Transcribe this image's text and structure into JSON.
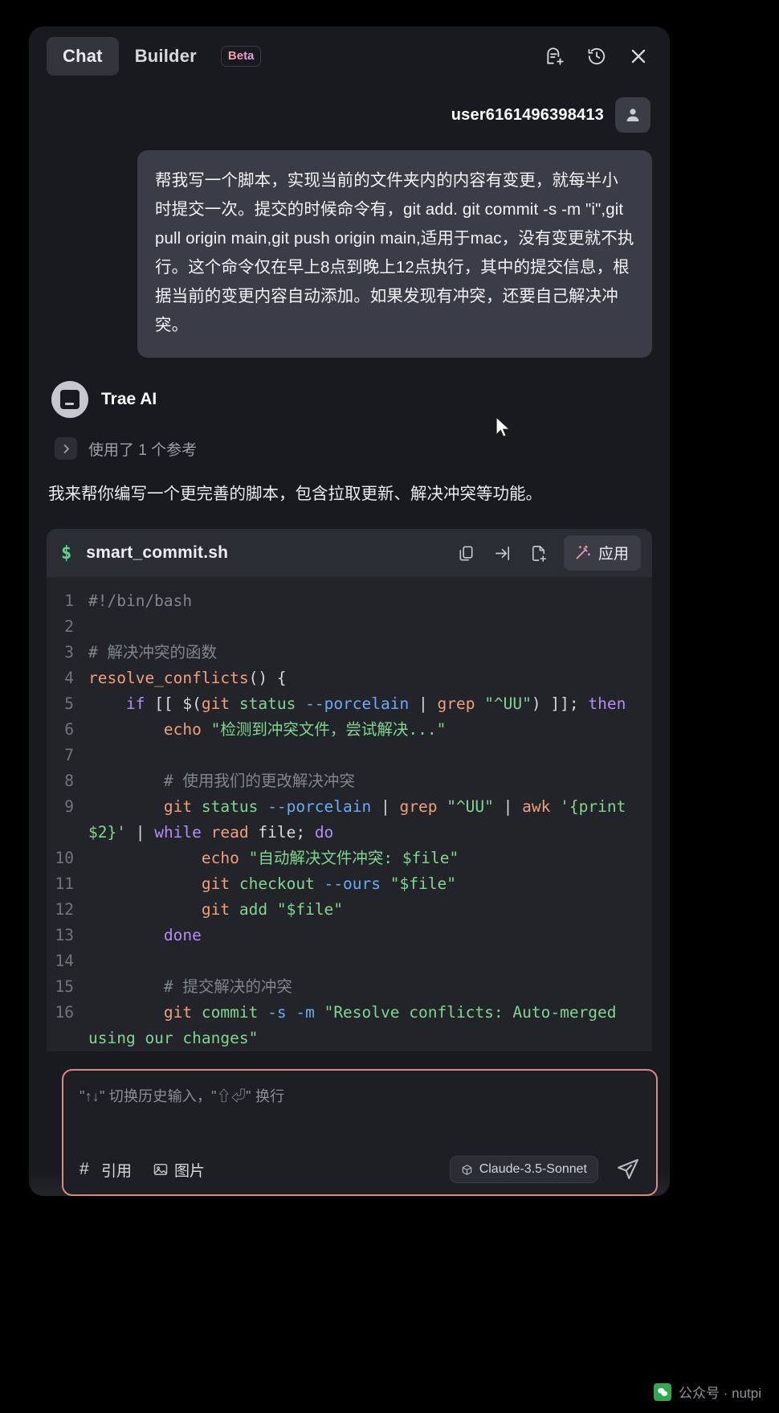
{
  "header": {
    "tab_chat": "Chat",
    "tab_builder": "Builder",
    "badge_beta": "Beta",
    "icon_new_chat": "new-chat-icon",
    "icon_history": "history-clock-icon",
    "icon_close": "close-icon"
  },
  "user": {
    "name": "user6161496398413",
    "message": "帮我写一个脚本，实现当前的文件夹内的内容有变更，就每半小时提交一次。提交的时候命令有，git add. git commit -s -m \"i\",git pull origin main,git push origin main,适用于mac，没有变更就不执行。这个命令仅在早上8点到晚上12点执行，其中的提交信息，根据当前的变更内容自动添加。如果发现有冲突，还要自己解决冲突。"
  },
  "assistant": {
    "name": "Trae AI",
    "reference_label": "使用了 1 个参考",
    "intro": "我来帮你编写一个更完善的脚本，包含拉取更新、解决冲突等功能。"
  },
  "code_block": {
    "prompt_symbol": "$",
    "filename": "smart_commit.sh",
    "icon_copy": "copy-icon",
    "icon_insert": "insert-at-cursor-icon",
    "icon_new_file": "new-file-icon",
    "apply_label": "应用",
    "apply_icon": "magic-wand-icon",
    "lines": [
      {
        "n": "1",
        "tokens": [
          {
            "t": "#!/bin/bash",
            "c": "c-com"
          }
        ]
      },
      {
        "n": "2",
        "tokens": []
      },
      {
        "n": "3",
        "tokens": [
          {
            "t": "# 解决冲突的函数",
            "c": "c-com"
          }
        ]
      },
      {
        "n": "4",
        "tokens": [
          {
            "t": "resolve_conflicts",
            "c": "c-fn"
          },
          {
            "t": "() {",
            "c": "c-pln"
          }
        ]
      },
      {
        "n": "5",
        "tokens": [
          {
            "t": "    ",
            "c": "c-pln"
          },
          {
            "t": "if",
            "c": "c-kw"
          },
          {
            "t": " [[ $(",
            "c": "c-pln"
          },
          {
            "t": "git",
            "c": "c-cmd"
          },
          {
            "t": " ",
            "c": "c-pln"
          },
          {
            "t": "status",
            "c": "c-arg"
          },
          {
            "t": " ",
            "c": "c-pln"
          },
          {
            "t": "--porcelain",
            "c": "c-flag"
          },
          {
            "t": " | ",
            "c": "c-pln"
          },
          {
            "t": "grep",
            "c": "c-cmd"
          },
          {
            "t": " ",
            "c": "c-pln"
          },
          {
            "t": "\"^UU\"",
            "c": "c-str"
          },
          {
            "t": ") ]]; ",
            "c": "c-pln"
          },
          {
            "t": "then",
            "c": "c-kw"
          }
        ]
      },
      {
        "n": "6",
        "tokens": [
          {
            "t": "        ",
            "c": "c-pln"
          },
          {
            "t": "echo",
            "c": "c-cmd"
          },
          {
            "t": " ",
            "c": "c-pln"
          },
          {
            "t": "\"检测到冲突文件，尝试解决...\"",
            "c": "c-str"
          }
        ]
      },
      {
        "n": "7",
        "tokens": []
      },
      {
        "n": "8",
        "tokens": [
          {
            "t": "        # 使用我们的更改解决冲突",
            "c": "c-com"
          }
        ]
      },
      {
        "n": "9",
        "tokens": [
          {
            "t": "        ",
            "c": "c-pln"
          },
          {
            "t": "git",
            "c": "c-cmd"
          },
          {
            "t": " ",
            "c": "c-pln"
          },
          {
            "t": "status",
            "c": "c-arg"
          },
          {
            "t": " ",
            "c": "c-pln"
          },
          {
            "t": "--porcelain",
            "c": "c-flag"
          },
          {
            "t": " | ",
            "c": "c-pln"
          },
          {
            "t": "grep",
            "c": "c-cmd"
          },
          {
            "t": " ",
            "c": "c-pln"
          },
          {
            "t": "\"^UU\"",
            "c": "c-str"
          },
          {
            "t": " | ",
            "c": "c-pln"
          },
          {
            "t": "awk",
            "c": "c-cmd"
          },
          {
            "t": " ",
            "c": "c-pln"
          },
          {
            "t": "'{print $2}'",
            "c": "c-str"
          },
          {
            "t": " | ",
            "c": "c-pln"
          },
          {
            "t": "while",
            "c": "c-kw"
          },
          {
            "t": " ",
            "c": "c-pln"
          },
          {
            "t": "read",
            "c": "c-cmd"
          },
          {
            "t": " file; ",
            "c": "c-pln"
          },
          {
            "t": "do",
            "c": "c-kw"
          }
        ]
      },
      {
        "n": "10",
        "tokens": [
          {
            "t": "            ",
            "c": "c-pln"
          },
          {
            "t": "echo",
            "c": "c-cmd"
          },
          {
            "t": " ",
            "c": "c-pln"
          },
          {
            "t": "\"自动解决文件冲突: $file\"",
            "c": "c-str"
          }
        ]
      },
      {
        "n": "11",
        "tokens": [
          {
            "t": "            ",
            "c": "c-pln"
          },
          {
            "t": "git",
            "c": "c-cmd"
          },
          {
            "t": " ",
            "c": "c-pln"
          },
          {
            "t": "checkout",
            "c": "c-arg"
          },
          {
            "t": " ",
            "c": "c-pln"
          },
          {
            "t": "--ours",
            "c": "c-flag"
          },
          {
            "t": " ",
            "c": "c-pln"
          },
          {
            "t": "\"$file\"",
            "c": "c-str"
          }
        ]
      },
      {
        "n": "12",
        "tokens": [
          {
            "t": "            ",
            "c": "c-pln"
          },
          {
            "t": "git",
            "c": "c-cmd"
          },
          {
            "t": " ",
            "c": "c-pln"
          },
          {
            "t": "add",
            "c": "c-arg"
          },
          {
            "t": " ",
            "c": "c-pln"
          },
          {
            "t": "\"$file\"",
            "c": "c-str"
          }
        ]
      },
      {
        "n": "13",
        "tokens": [
          {
            "t": "        ",
            "c": "c-pln"
          },
          {
            "t": "done",
            "c": "c-kw"
          }
        ]
      },
      {
        "n": "14",
        "tokens": []
      },
      {
        "n": "15",
        "tokens": [
          {
            "t": "        # 提交解决的冲突",
            "c": "c-com"
          }
        ]
      },
      {
        "n": "16",
        "tokens": [
          {
            "t": "        ",
            "c": "c-pln"
          },
          {
            "t": "git",
            "c": "c-cmd"
          },
          {
            "t": " ",
            "c": "c-pln"
          },
          {
            "t": "commit",
            "c": "c-arg"
          },
          {
            "t": " ",
            "c": "c-pln"
          },
          {
            "t": "-s",
            "c": "c-flag"
          },
          {
            "t": " ",
            "c": "c-pln"
          },
          {
            "t": "-m",
            "c": "c-flag"
          },
          {
            "t": " ",
            "c": "c-pln"
          },
          {
            "t": "\"Resolve conflicts: Auto-merged using our changes\"",
            "c": "c-str"
          }
        ]
      }
    ]
  },
  "composer": {
    "placeholder": "\"↑↓\" 切换历史输入，\"⇧⏎\" 换行",
    "quote_label": "引用",
    "quote_prefix": "#",
    "image_label": "图片",
    "image_icon": "image-icon",
    "model": "Claude-3.5-Sonnet",
    "model_icon": "cube-icon",
    "send_icon": "send-icon"
  },
  "watermark": {
    "text": "公众号 · nutpi",
    "logo": "wechat-icon"
  },
  "colors": {
    "panel_bg": "#181a1f",
    "bubble_bg": "#3a3d47",
    "code_bg": "#222429",
    "code_head_bg": "#2a2d34",
    "composer_border": "#d98a7d",
    "accent_green": "#5fd68a"
  }
}
